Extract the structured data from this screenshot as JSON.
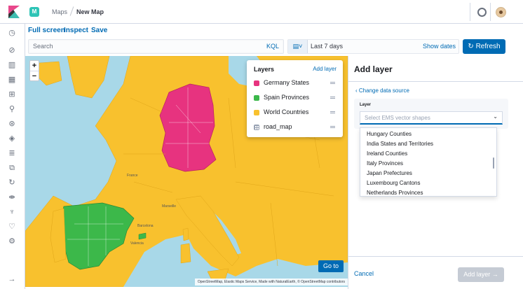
{
  "header": {
    "app_badge": "M",
    "breadcrumbs": [
      "Maps",
      "New Map"
    ]
  },
  "sidenav": {
    "icons": [
      "recent-icon",
      "discover-icon",
      "visualize-icon",
      "dashboard-icon",
      "canvas-icon",
      "maps-icon",
      "ml-icon",
      "infrastructure-icon",
      "logs-icon",
      "apm-icon",
      "uptime-icon",
      "siem-icon",
      "dev-tools-icon",
      "monitoring-icon",
      "management-icon",
      "collapse-icon"
    ]
  },
  "toolbar": {
    "full_screen": "Full screen",
    "inspect": "Inspect",
    "save": "Save"
  },
  "query": {
    "search_placeholder": "Search",
    "kql": "KQL",
    "time_range": "Last 7 days",
    "show_dates": "Show dates",
    "refresh": "Refresh"
  },
  "map": {
    "zoom_in": "+",
    "zoom_out": "−",
    "go_to": "Go to",
    "attribution": "OpenStreetMap, Elastic Maps Service, Made with NaturalEarth, © OpenStreetMap contributors",
    "labels": [
      "France",
      "Marseille",
      "Barcelona",
      "Valencia"
    ]
  },
  "layers": {
    "title": "Layers",
    "add": "Add layer",
    "items": [
      {
        "name": "Germany States",
        "color": "#e7337f"
      },
      {
        "name": "Spain Provinces",
        "color": "#3cb84a"
      },
      {
        "name": "World Countries",
        "color": "#f8c12e"
      },
      {
        "name": "road_map",
        "color": "#98a2b3"
      }
    ]
  },
  "panel": {
    "title": "Add layer",
    "change_source": "Change data source",
    "field_label": "Layer",
    "select_placeholder": "Select EMS vector shapes",
    "options": [
      "Hungary Counties",
      "India States and Territories",
      "Ireland Counties",
      "Italy Provinces",
      "Japan Prefectures",
      "Luxembourg Cantons",
      "Netherlands Provinces"
    ],
    "cancel": "Cancel",
    "add_layer": "Add layer"
  },
  "colors": {
    "accent": "#006bb4",
    "germany": "#e7337f",
    "spain": "#3cb84a",
    "world": "#f8c12e",
    "water": "#a8d8e8"
  }
}
